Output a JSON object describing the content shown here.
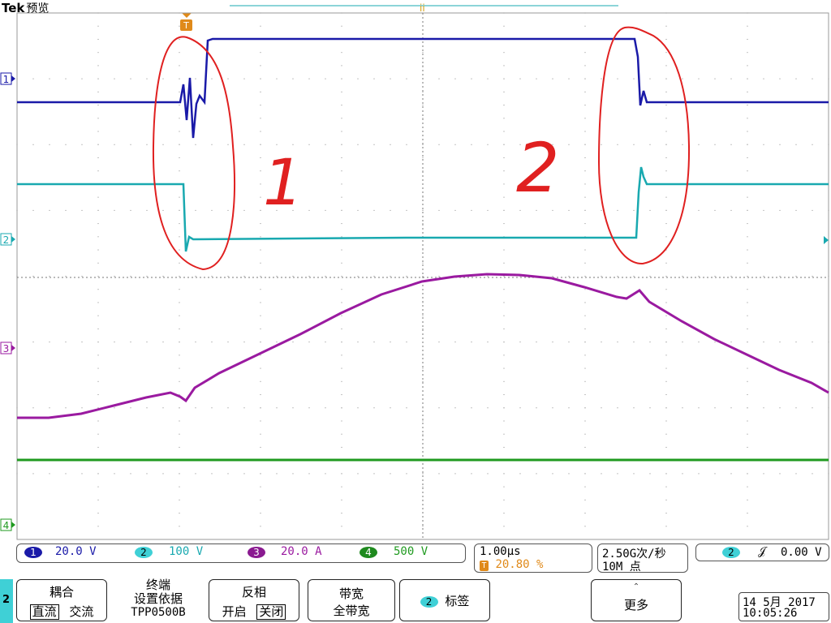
{
  "header": {
    "brand": "Tek",
    "mode": "预览"
  },
  "trigger_marker": "T",
  "channel_markers": [
    "1",
    "2",
    "3",
    "4"
  ],
  "annotations": [
    "1",
    "2"
  ],
  "channels": [
    {
      "num": "1",
      "scale": "20.0 V",
      "color": "#1a1aa8"
    },
    {
      "num": "2",
      "scale": "100 V",
      "color": "#19a9b0"
    },
    {
      "num": "3",
      "scale": "20.0 A",
      "color": "#9a1aa0"
    },
    {
      "num": "4",
      "scale": "500 V",
      "color": "#1f9a1f"
    }
  ],
  "timebase": {
    "scale": "1.00µs",
    "trigger_pos": "20.80 %"
  },
  "acquisition": {
    "rate": "2.50G次/秒",
    "points": "10M 点"
  },
  "trigger": {
    "channel": "2",
    "slope": "𝒥",
    "level": "0.00 V"
  },
  "side_tab": "2",
  "menu": {
    "coupling": {
      "title": "耦合",
      "opt1": "直流",
      "opt2": "交流"
    },
    "termination": {
      "line1": "终端",
      "line2": "设置依据",
      "line3": "TPP0500B"
    },
    "invert": {
      "title": "反相",
      "opt1": "开启",
      "opt2": "关闭"
    },
    "bandwidth": {
      "title": "带宽",
      "value": "全带宽"
    },
    "label": {
      "num": "2",
      "text": "标签"
    },
    "more": {
      "text": "更多"
    }
  },
  "datetime": {
    "date": "14 5月  2017",
    "time": "10:05:26"
  }
}
